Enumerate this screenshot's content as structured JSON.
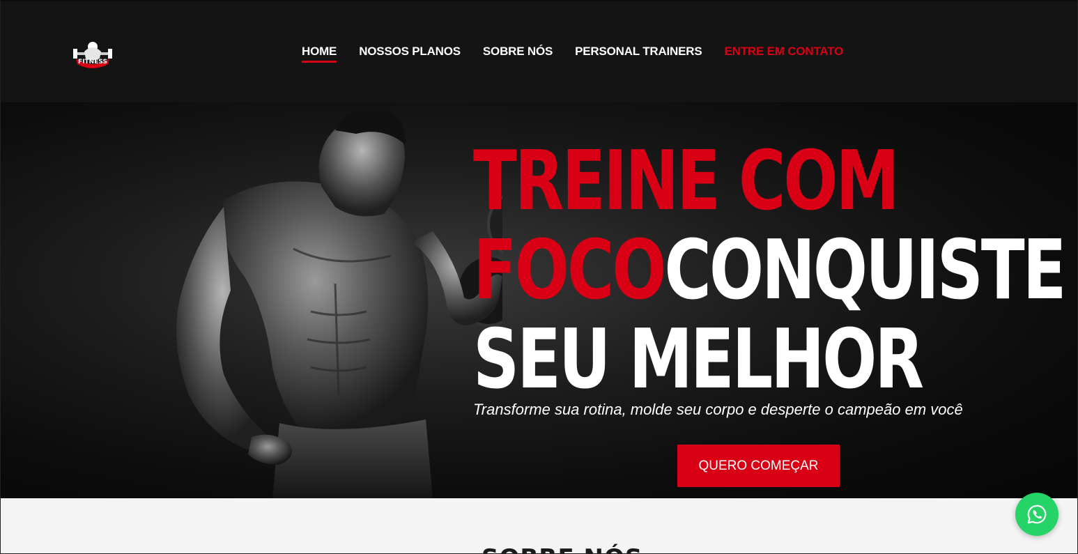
{
  "header": {
    "logo_text": "FITNESS",
    "nav": [
      {
        "label": "HOME"
      },
      {
        "label": "NOSSOS PLANOS"
      },
      {
        "label": "SOBRE NÓS"
      },
      {
        "label": "PERSONAL TRAINERS"
      },
      {
        "label": "ENTRE EM CONTATO"
      }
    ],
    "active_nav": "HOME",
    "highlight_nav": "ENTRE EM CONTATO"
  },
  "hero": {
    "headline_red_1": "TREINE COM",
    "headline_red_2": "FOCO",
    "headline_white_2": "CONQUISTE",
    "headline_white_3": "SEU MELHOR",
    "subtitle": "Transforme sua rotina, molde seu corpo e desperte o campeão em você",
    "cta_label": "QUERO COMEÇAR"
  },
  "about": {
    "title": "SOBRE NÓS"
  },
  "floating": {
    "whatsapp_icon": "whatsapp-icon"
  },
  "colors": {
    "accent": "#d90015",
    "header_bg": "#141414",
    "whatsapp": "#25d366"
  }
}
